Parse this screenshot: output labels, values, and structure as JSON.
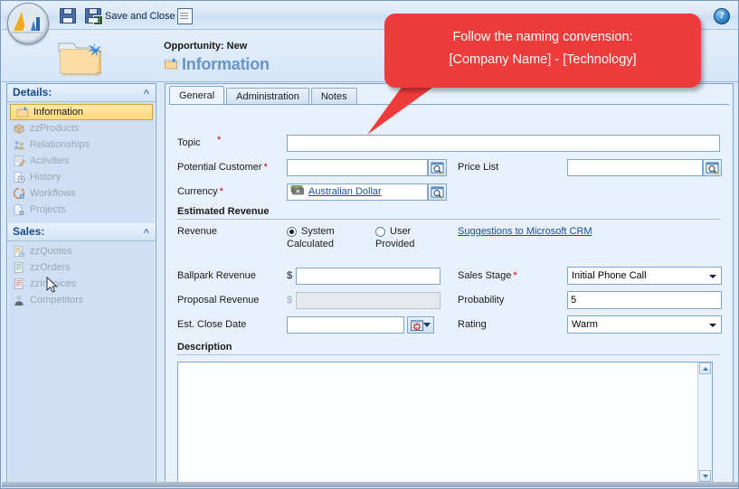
{
  "window": {
    "logo_icon": "dynamics-crm-logo-icon"
  },
  "toolbar": {
    "save_label": "",
    "save_icon": "save-floppy-icon",
    "save_and_close_label": "Save and Close",
    "save_and_close_icon": "save-and-close-icon",
    "new_icon": "new-record-icon",
    "help_icon": "help-question-icon",
    "help_label": "?"
  },
  "header": {
    "entity_label": "Opportunity: New",
    "form_title": "Information",
    "folder_icon": "folder-new-icon",
    "title_icon": "opportunity-folder-icon"
  },
  "callout": {
    "line1": "Follow the naming convension:",
    "line2": "[Company Name] - [Technology]",
    "color": "#ee3b3b"
  },
  "sidebar": {
    "groups": [
      {
        "title": "Details:",
        "collapse_icon": "chevron-up-icon",
        "items": [
          {
            "label": "Information",
            "icon": "folder-info-icon",
            "selected": true
          },
          {
            "label": "zzProducts",
            "icon": "box-icon",
            "selected": false
          },
          {
            "label": "Relationships",
            "icon": "relationships-icon",
            "selected": false
          },
          {
            "label": "Activities",
            "icon": "activities-notepad-icon",
            "selected": false
          },
          {
            "label": "History",
            "icon": "history-clock-icon",
            "selected": false
          },
          {
            "label": "Workflows",
            "icon": "workflow-icon",
            "selected": false
          },
          {
            "label": "Projects",
            "icon": "projects-icon",
            "selected": false
          }
        ]
      },
      {
        "title": "Sales:",
        "collapse_icon": "chevron-up-icon",
        "items": [
          {
            "label": "zzQuotes",
            "icon": "quote-document-icon",
            "selected": false
          },
          {
            "label": "zzOrders",
            "icon": "order-document-icon",
            "selected": false
          },
          {
            "label": "zzInvoices",
            "icon": "invoice-document-icon",
            "selected": false
          },
          {
            "label": "Competitors",
            "icon": "competitor-person-icon",
            "selected": false
          }
        ]
      }
    ]
  },
  "tabs": [
    {
      "label": "General",
      "active": true
    },
    {
      "label": "Administration",
      "active": false
    },
    {
      "label": "Notes",
      "active": false
    }
  ],
  "form": {
    "topic": {
      "label": "Topic",
      "required": true,
      "value": ""
    },
    "potential_customer": {
      "label": "Potential Customer",
      "required": true,
      "value": "",
      "lookup_icon": "lookup-search-icon"
    },
    "price_list": {
      "label": "Price List",
      "required": false,
      "value": "",
      "lookup_icon": "lookup-search-icon"
    },
    "currency": {
      "label": "Currency",
      "required": true,
      "value": "Australian Dollar",
      "value_icon": "currency-money-icon",
      "lookup_icon": "lookup-search-icon"
    },
    "estimated_revenue_section": "Estimated Revenue",
    "revenue": {
      "label": "Revenue",
      "options": [
        {
          "label_line1": "System",
          "label_line2": "Calculated",
          "selected": true
        },
        {
          "label_line1": "User",
          "label_line2": "Provided",
          "selected": false
        }
      ]
    },
    "suggestions_link": "Suggestions to Microsoft CRM",
    "ballpark_revenue": {
      "label": "Ballpark Revenue",
      "currency_symbol": "$",
      "value": "",
      "disabled": false
    },
    "proposal_revenue": {
      "label": "Proposal Revenue",
      "currency_symbol": "$",
      "value": "",
      "disabled": true
    },
    "est_close_date": {
      "label": "Est. Close Date",
      "value": "",
      "calendar_icon": "calendar-icon",
      "dropdown_icon": "chevron-down-icon"
    },
    "sales_stage": {
      "label": "Sales Stage",
      "required": true,
      "value": "Initial Phone Call"
    },
    "probability": {
      "label": "Probability",
      "required": false,
      "value": "5"
    },
    "rating": {
      "label": "Rating",
      "required": false,
      "value": "Warm"
    },
    "description_section": "Description",
    "description": {
      "value": ""
    }
  }
}
